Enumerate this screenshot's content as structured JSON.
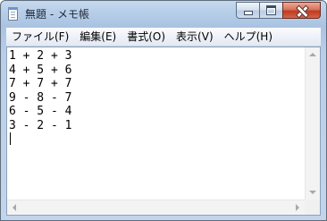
{
  "window": {
    "title": "無題 - メモ帳",
    "icon": "notepad-icon"
  },
  "caption_buttons": {
    "minimize_icon": "minimize-icon",
    "maximize_icon": "maximize-icon",
    "close_icon": "close-icon"
  },
  "menu": {
    "items": [
      {
        "label": "ファイル(F)"
      },
      {
        "label": "編集(E)"
      },
      {
        "label": "書式(O)"
      },
      {
        "label": "表示(V)"
      },
      {
        "label": "ヘルプ(H)"
      }
    ]
  },
  "editor": {
    "lines": [
      "1 + 2 + 3",
      "4 + 5 + 6",
      "7 + 7 + 7",
      "9 - 8 - 7",
      "6 - 5 - 4",
      "3 - 2 - 1"
    ]
  },
  "colors": {
    "titlebar": "#b8cfe9",
    "close_button": "#c2391c",
    "editor_background": "#ffffff"
  }
}
